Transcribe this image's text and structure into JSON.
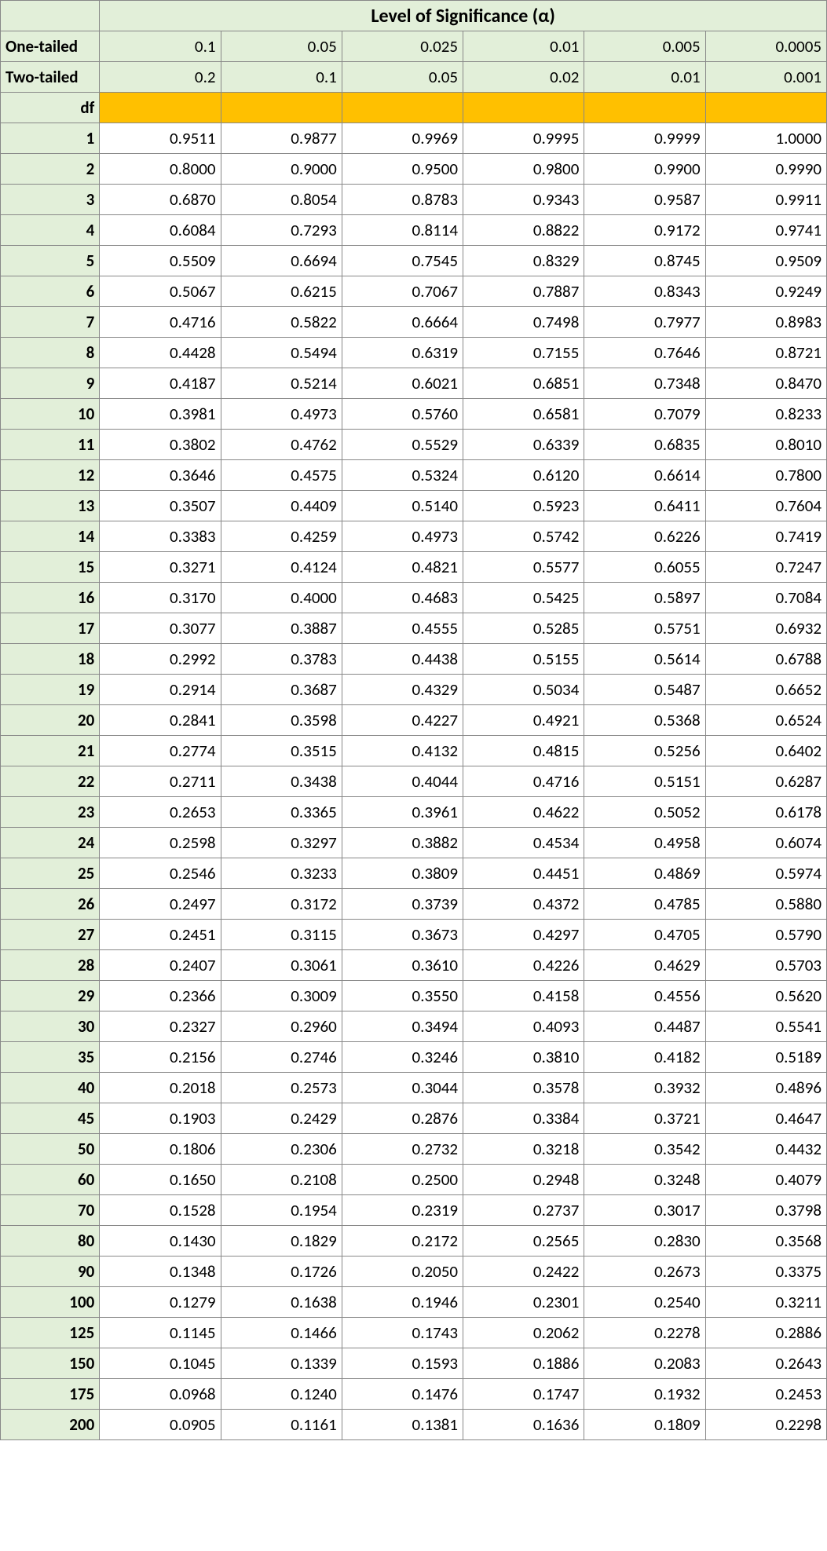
{
  "chart_data": {
    "type": "table",
    "title": "Level of Significance (α)",
    "row_labels": {
      "one_tailed": "One-tailed",
      "two_tailed": "Two-tailed",
      "df": "df"
    },
    "alpha_one_tailed": [
      "0.1",
      "0.05",
      "0.025",
      "0.01",
      "0.005",
      "0.0005"
    ],
    "alpha_two_tailed": [
      "0.2",
      "0.1",
      "0.05",
      "0.02",
      "0.01",
      "0.001"
    ],
    "df": [
      "1",
      "2",
      "3",
      "4",
      "5",
      "6",
      "7",
      "8",
      "9",
      "10",
      "11",
      "12",
      "13",
      "14",
      "15",
      "16",
      "17",
      "18",
      "19",
      "20",
      "21",
      "22",
      "23",
      "24",
      "25",
      "26",
      "27",
      "28",
      "29",
      "30",
      "35",
      "40",
      "45",
      "50",
      "60",
      "70",
      "80",
      "90",
      "100",
      "125",
      "150",
      "175",
      "200"
    ],
    "values": [
      [
        "0.9511",
        "0.9877",
        "0.9969",
        "0.9995",
        "0.9999",
        "1.0000"
      ],
      [
        "0.8000",
        "0.9000",
        "0.9500",
        "0.9800",
        "0.9900",
        "0.9990"
      ],
      [
        "0.6870",
        "0.8054",
        "0.8783",
        "0.9343",
        "0.9587",
        "0.9911"
      ],
      [
        "0.6084",
        "0.7293",
        "0.8114",
        "0.8822",
        "0.9172",
        "0.9741"
      ],
      [
        "0.5509",
        "0.6694",
        "0.7545",
        "0.8329",
        "0.8745",
        "0.9509"
      ],
      [
        "0.5067",
        "0.6215",
        "0.7067",
        "0.7887",
        "0.8343",
        "0.9249"
      ],
      [
        "0.4716",
        "0.5822",
        "0.6664",
        "0.7498",
        "0.7977",
        "0.8983"
      ],
      [
        "0.4428",
        "0.5494",
        "0.6319",
        "0.7155",
        "0.7646",
        "0.8721"
      ],
      [
        "0.4187",
        "0.5214",
        "0.6021",
        "0.6851",
        "0.7348",
        "0.8470"
      ],
      [
        "0.3981",
        "0.4973",
        "0.5760",
        "0.6581",
        "0.7079",
        "0.8233"
      ],
      [
        "0.3802",
        "0.4762",
        "0.5529",
        "0.6339",
        "0.6835",
        "0.8010"
      ],
      [
        "0.3646",
        "0.4575",
        "0.5324",
        "0.6120",
        "0.6614",
        "0.7800"
      ],
      [
        "0.3507",
        "0.4409",
        "0.5140",
        "0.5923",
        "0.6411",
        "0.7604"
      ],
      [
        "0.3383",
        "0.4259",
        "0.4973",
        "0.5742",
        "0.6226",
        "0.7419"
      ],
      [
        "0.3271",
        "0.4124",
        "0.4821",
        "0.5577",
        "0.6055",
        "0.7247"
      ],
      [
        "0.3170",
        "0.4000",
        "0.4683",
        "0.5425",
        "0.5897",
        "0.7084"
      ],
      [
        "0.3077",
        "0.3887",
        "0.4555",
        "0.5285",
        "0.5751",
        "0.6932"
      ],
      [
        "0.2992",
        "0.3783",
        "0.4438",
        "0.5155",
        "0.5614",
        "0.6788"
      ],
      [
        "0.2914",
        "0.3687",
        "0.4329",
        "0.5034",
        "0.5487",
        "0.6652"
      ],
      [
        "0.2841",
        "0.3598",
        "0.4227",
        "0.4921",
        "0.5368",
        "0.6524"
      ],
      [
        "0.2774",
        "0.3515",
        "0.4132",
        "0.4815",
        "0.5256",
        "0.6402"
      ],
      [
        "0.2711",
        "0.3438",
        "0.4044",
        "0.4716",
        "0.5151",
        "0.6287"
      ],
      [
        "0.2653",
        "0.3365",
        "0.3961",
        "0.4622",
        "0.5052",
        "0.6178"
      ],
      [
        "0.2598",
        "0.3297",
        "0.3882",
        "0.4534",
        "0.4958",
        "0.6074"
      ],
      [
        "0.2546",
        "0.3233",
        "0.3809",
        "0.4451",
        "0.4869",
        "0.5974"
      ],
      [
        "0.2497",
        "0.3172",
        "0.3739",
        "0.4372",
        "0.4785",
        "0.5880"
      ],
      [
        "0.2451",
        "0.3115",
        "0.3673",
        "0.4297",
        "0.4705",
        "0.5790"
      ],
      [
        "0.2407",
        "0.3061",
        "0.3610",
        "0.4226",
        "0.4629",
        "0.5703"
      ],
      [
        "0.2366",
        "0.3009",
        "0.3550",
        "0.4158",
        "0.4556",
        "0.5620"
      ],
      [
        "0.2327",
        "0.2960",
        "0.3494",
        "0.4093",
        "0.4487",
        "0.5541"
      ],
      [
        "0.2156",
        "0.2746",
        "0.3246",
        "0.3810",
        "0.4182",
        "0.5189"
      ],
      [
        "0.2018",
        "0.2573",
        "0.3044",
        "0.3578",
        "0.3932",
        "0.4896"
      ],
      [
        "0.1903",
        "0.2429",
        "0.2876",
        "0.3384",
        "0.3721",
        "0.4647"
      ],
      [
        "0.1806",
        "0.2306",
        "0.2732",
        "0.3218",
        "0.3542",
        "0.4432"
      ],
      [
        "0.1650",
        "0.2108",
        "0.2500",
        "0.2948",
        "0.3248",
        "0.4079"
      ],
      [
        "0.1528",
        "0.1954",
        "0.2319",
        "0.2737",
        "0.3017",
        "0.3798"
      ],
      [
        "0.1430",
        "0.1829",
        "0.2172",
        "0.2565",
        "0.2830",
        "0.3568"
      ],
      [
        "0.1348",
        "0.1726",
        "0.2050",
        "0.2422",
        "0.2673",
        "0.3375"
      ],
      [
        "0.1279",
        "0.1638",
        "0.1946",
        "0.2301",
        "0.2540",
        "0.3211"
      ],
      [
        "0.1145",
        "0.1466",
        "0.1743",
        "0.2062",
        "0.2278",
        "0.2886"
      ],
      [
        "0.1045",
        "0.1339",
        "0.1593",
        "0.1886",
        "0.2083",
        "0.2643"
      ],
      [
        "0.0968",
        "0.1240",
        "0.1476",
        "0.1747",
        "0.1932",
        "0.2453"
      ],
      [
        "0.0905",
        "0.1161",
        "0.1381",
        "0.1636",
        "0.1809",
        "0.2298"
      ]
    ]
  }
}
